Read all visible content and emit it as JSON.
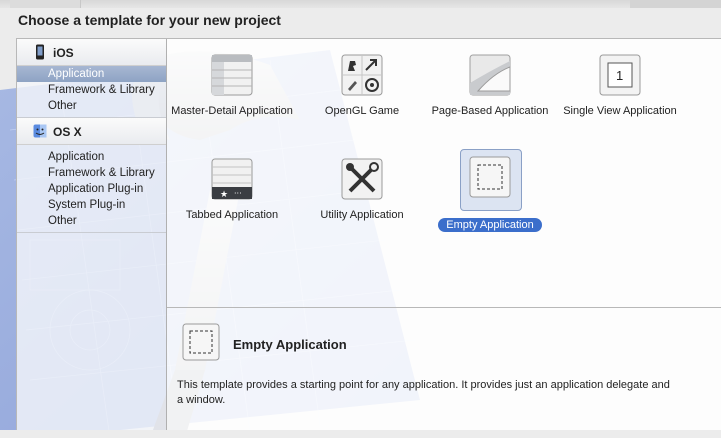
{
  "dialog": {
    "title": "Choose a template for your new project"
  },
  "sidebar": {
    "sections": [
      {
        "label": "iOS",
        "icon": "iphone-icon",
        "items": [
          {
            "label": "Application",
            "selected": true
          },
          {
            "label": "Framework & Library",
            "selected": false
          },
          {
            "label": "Other",
            "selected": false
          }
        ]
      },
      {
        "label": "OS X",
        "icon": "finder-icon",
        "items": [
          {
            "label": "Application",
            "selected": false
          },
          {
            "label": "Framework & Library",
            "selected": false
          },
          {
            "label": "Application Plug-in",
            "selected": false
          },
          {
            "label": "System Plug-in",
            "selected": false
          },
          {
            "label": "Other",
            "selected": false
          }
        ]
      }
    ]
  },
  "templates": [
    {
      "label": "Master-Detail Application",
      "icon": "master-detail-icon"
    },
    {
      "label": "OpenGL Game",
      "icon": "opengl-game-icon"
    },
    {
      "label": "Page-Based Application",
      "icon": "page-curl-icon"
    },
    {
      "label": "Single View Application",
      "icon": "single-view-icon",
      "badge": "1"
    },
    {
      "label": "Tabbed Application",
      "icon": "tab-bar-icon"
    },
    {
      "label": "Utility Application",
      "icon": "tools-icon"
    },
    {
      "label": "Empty Application",
      "icon": "empty-app-icon",
      "selected": true
    }
  ],
  "description": {
    "title": "Empty Application",
    "text": "This template provides a starting point for any application. It provides just an application delegate and a window."
  },
  "colors": {
    "selection": "#3b6ecb",
    "sidebar_selection": "#97aac8",
    "blueprint": "#3f64c9"
  }
}
